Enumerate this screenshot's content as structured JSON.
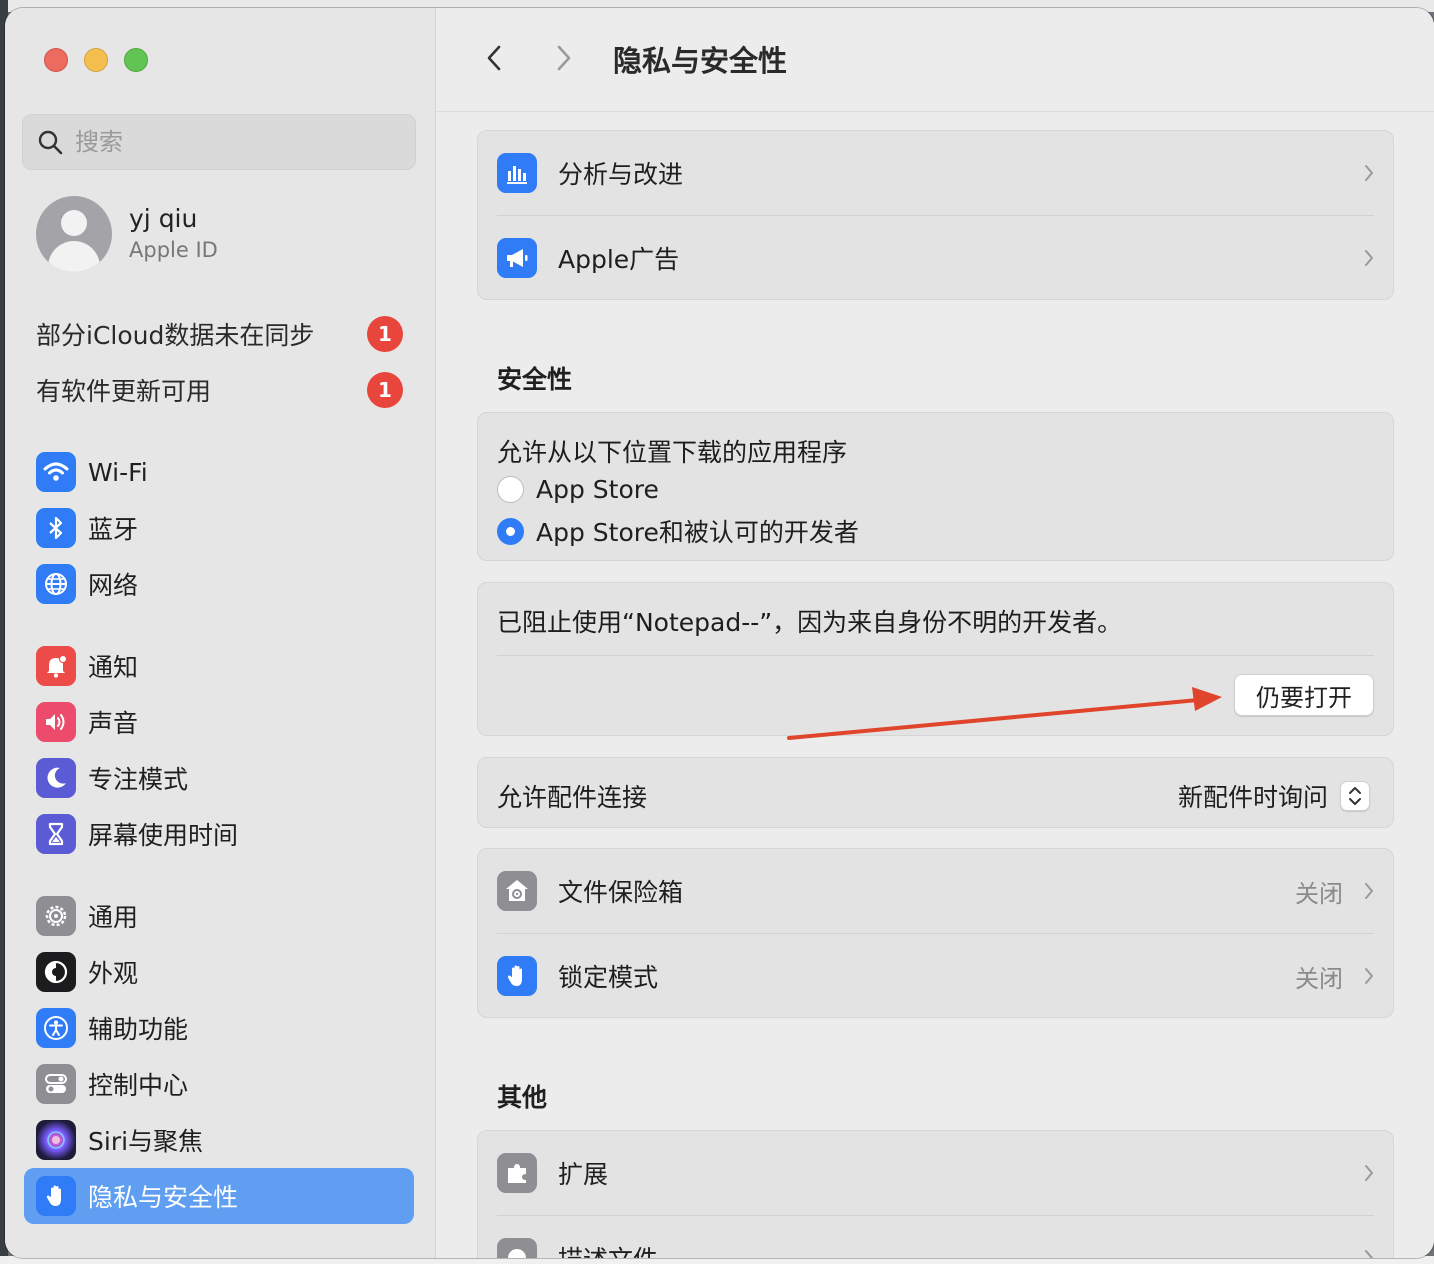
{
  "window": {
    "title": "隐私与安全性"
  },
  "search": {
    "placeholder": "搜索"
  },
  "account": {
    "name": "yj qiu",
    "subtitle": "Apple ID"
  },
  "notices": [
    {
      "label": "部分iCloud数据未在同步",
      "badge": "1"
    },
    {
      "label": "有软件更新可用",
      "badge": "1"
    }
  ],
  "sidebar": {
    "items": [
      {
        "label": "Wi-Fi",
        "icon": "wifi-icon",
        "color": "#2f7cf6"
      },
      {
        "label": "蓝牙",
        "icon": "bluetooth-icon",
        "color": "#2f7cf6"
      },
      {
        "label": "网络",
        "icon": "globe-icon",
        "color": "#2f7cf6"
      },
      {
        "label": "通知",
        "icon": "bell-icon",
        "color": "#ec4b48"
      },
      {
        "label": "声音",
        "icon": "speaker-icon",
        "color": "#ec4b6b"
      },
      {
        "label": "专注模式",
        "icon": "moon-icon",
        "color": "#5b5bd6"
      },
      {
        "label": "屏幕使用时间",
        "icon": "hourglass-icon",
        "color": "#5b5bd6"
      },
      {
        "label": "通用",
        "icon": "gear-icon",
        "color": "#8e8e93"
      },
      {
        "label": "外观",
        "icon": "appearance-icon",
        "color": "#1c1c1e"
      },
      {
        "label": "辅助功能",
        "icon": "accessibility-icon",
        "color": "#2f7cf6"
      },
      {
        "label": "控制中心",
        "icon": "toggles-icon",
        "color": "#8e8e93"
      },
      {
        "label": "Siri与聚焦",
        "icon": "siri-icon",
        "color": "#3a2f6b"
      },
      {
        "label": "隐私与安全性",
        "icon": "hand-icon",
        "color": "#2f7cf6",
        "selected": true
      }
    ]
  },
  "main": {
    "top_card": [
      {
        "label": "分析与改进",
        "icon": "chart-icon"
      },
      {
        "label": "Apple广告",
        "icon": "megaphone-icon"
      }
    ],
    "security_heading": "安全性",
    "downloads": {
      "title": "允许从以下位置下载的应用程序",
      "options": [
        {
          "label": "App Store",
          "selected": false
        },
        {
          "label": "App Store和被认可的开发者",
          "selected": true
        }
      ]
    },
    "blocked": {
      "message": "已阻止使用“Notepad--”，因为来自身份不明的开发者。",
      "button": "仍要打开"
    },
    "accessories": {
      "label": "允许配件连接",
      "value": "新配件时询问"
    },
    "security_items": [
      {
        "label": "文件保险箱",
        "value": "关闭",
        "icon": "vault-icon"
      },
      {
        "label": "锁定模式",
        "value": "关闭",
        "icon": "hand-icon"
      }
    ],
    "other_heading": "其他",
    "other_items": [
      {
        "label": "扩展",
        "icon": "extension-icon"
      },
      {
        "label": "描述文件",
        "icon": "profile-icon"
      }
    ]
  },
  "annotation": {
    "arrow_color": "#e0442b"
  }
}
